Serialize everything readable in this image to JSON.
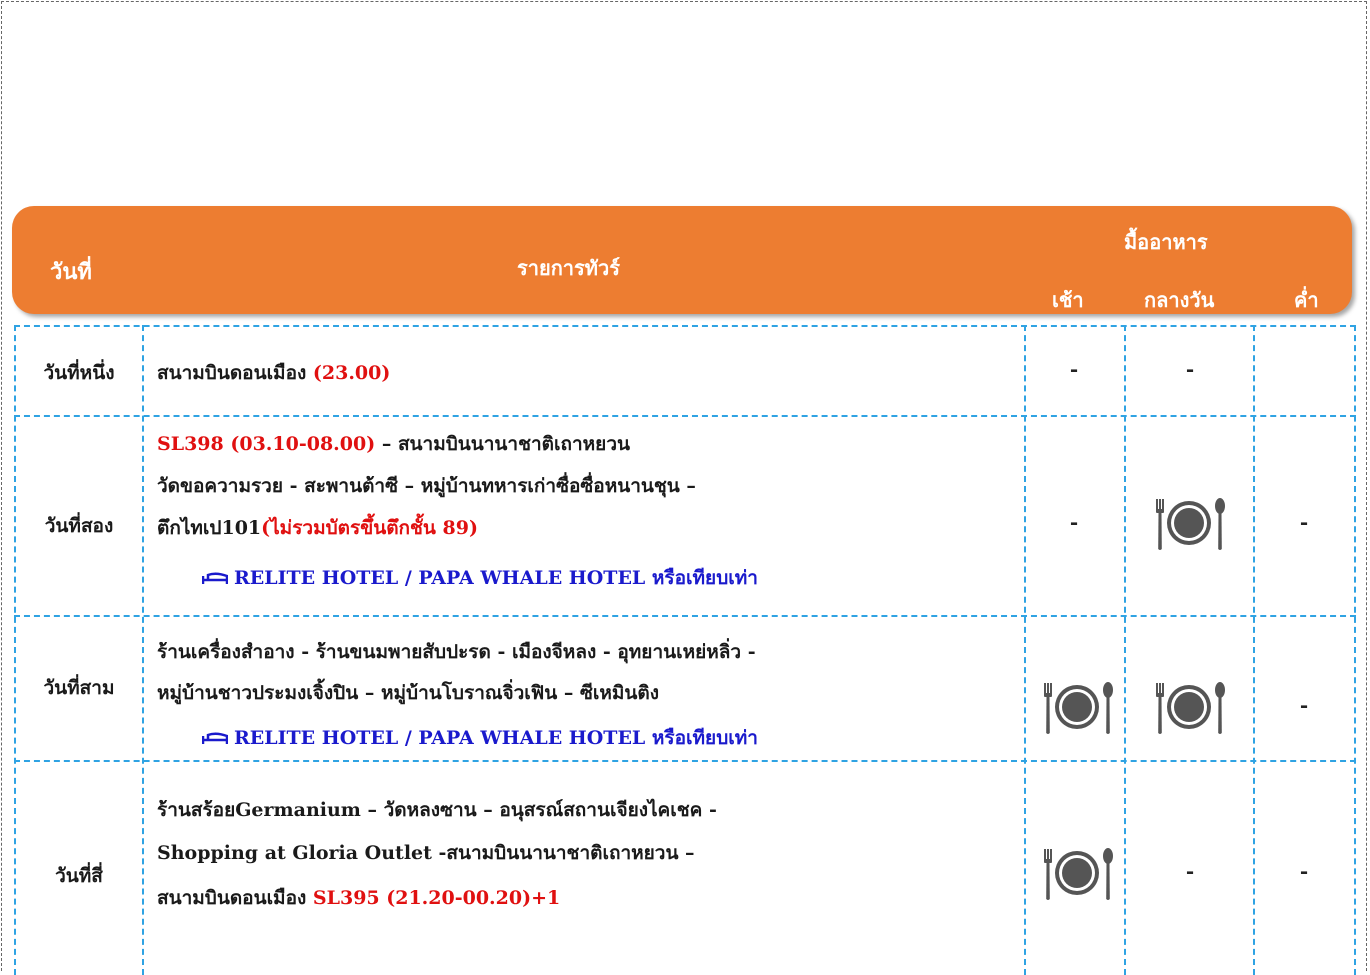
{
  "header": {
    "day_col": "วันที่",
    "program_col": "รายการทัวร์",
    "meals_col": "มื้ออาหาร",
    "breakfast": "เช้า",
    "lunch": "กลางวัน",
    "dinner": "ค่ำ"
  },
  "rows": [
    {
      "day": "วันที่หนึ่ง",
      "line1_a": "สนามบินดอนเมือง ",
      "line1_b": "(23.00)",
      "breakfast": "-",
      "lunch": "-",
      "dinner": ""
    },
    {
      "day": "วันที่สอง",
      "line1_a": "SL398 (03.10-08.00)",
      "line1_b": " – สนามบินนานาชาติเถาหยวน",
      "line2": "วัดขอความรวย - สะพานต้าซี – หมู่บ้านทหารเก่าซื่อซื่อหนานชุน –",
      "line3_a": "ตึกไทเป101",
      "line3_b": "(ไม่รวมบัตรขึ้นตึกชั้น 89)",
      "hotel": "RELITE HOTEL / PAPA WHALE HOTEL หรือเทียบเท่า",
      "breakfast": "-",
      "lunch_icon": "plate-cutlery-icon",
      "dinner": "-"
    },
    {
      "day": "วันที่สาม",
      "line1": "ร้านเครื่องสำอาง - ร้านขนมพายสับปะรด - เมืองจีหลง - อุทยานเหย่หลิ่ว -",
      "line2": "หมู่บ้านชาวประมงเจิ้งปิน – หมู่บ้านโบราณจิ่วเฟิน – ซีเหมินติง",
      "hotel": "RELITE HOTEL / PAPA WHALE HOTEL หรือเทียบเท่า",
      "breakfast_icon": "plate-cutlery-icon",
      "lunch_icon": "plate-cutlery-icon",
      "dinner": "-"
    },
    {
      "day": "วันที่สี่",
      "line1": "ร้านสร้อยGermanium – วัดหลงซาน – อนุสรณ์สถานเจียงไคเชค -",
      "line2": "Shopping at Gloria Outlet -สนามบินนานาชาติเถาหยวน –",
      "line3_a": "สนามบินดอนเมือง ",
      "line3_b": "SL395 (21.20-00.20)+1",
      "breakfast_icon": "plate-cutlery-icon",
      "lunch": "-",
      "dinner": "-"
    }
  ],
  "colors": {
    "header_bg": "#ed7d31",
    "grid_line": "#2fa3e3",
    "highlight_red": "#e01010",
    "hotel_blue": "#1a1acc"
  }
}
